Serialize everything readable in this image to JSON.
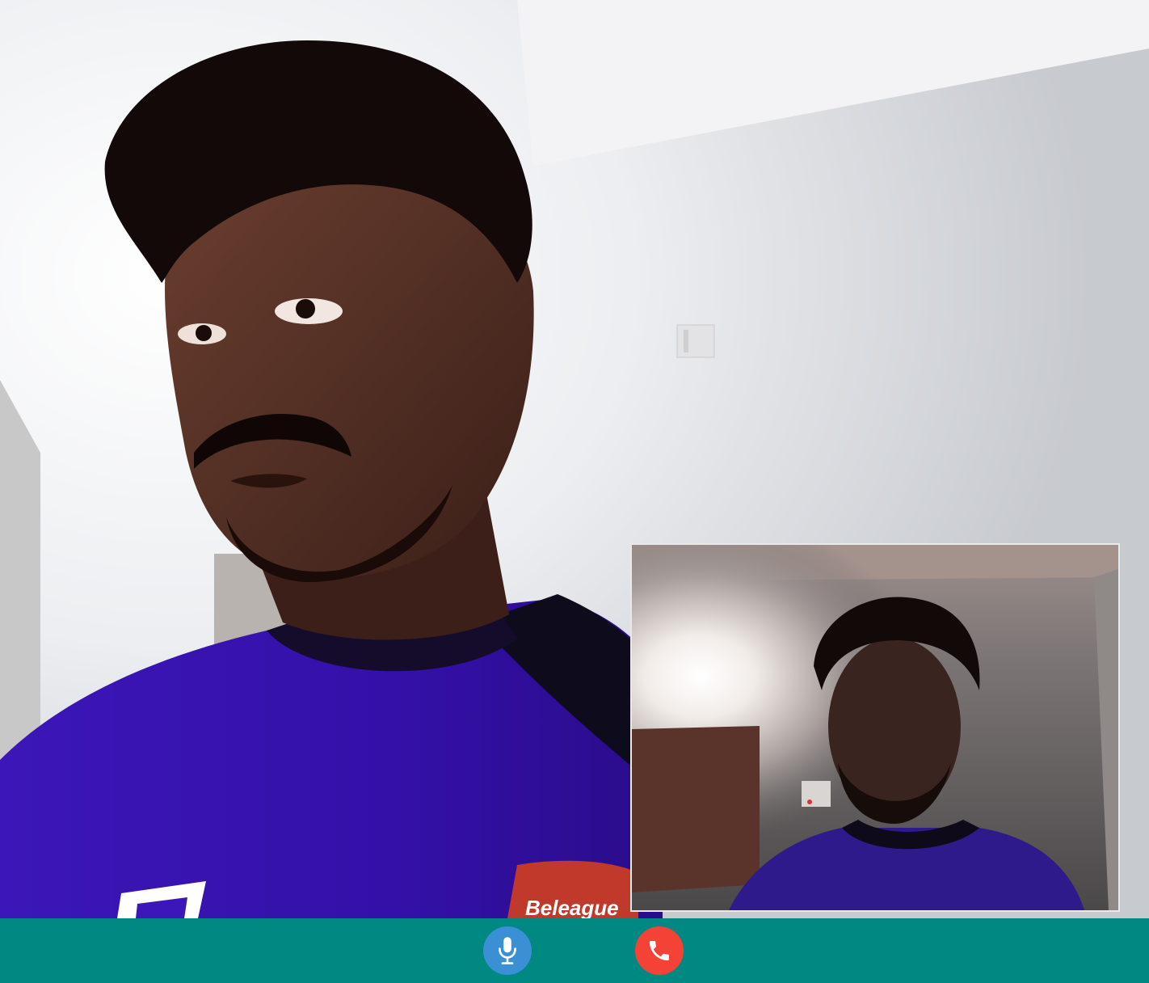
{
  "call": {
    "remote_participant": {
      "video": "remote-camera-feed",
      "shirt_text": "Beleague"
    },
    "local_participant": {
      "video": "self-camera-preview"
    }
  },
  "controls": {
    "background_color": "#008882",
    "mic": {
      "icon": "microphone-icon",
      "color": "#3b8fd4"
    },
    "hangup": {
      "icon": "phone-icon",
      "color": "#f44336"
    }
  }
}
